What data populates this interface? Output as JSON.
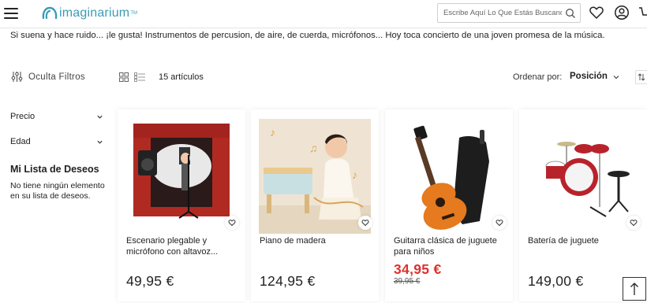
{
  "header": {
    "logo_text": "imaginarium",
    "logo_mark": "TM",
    "search_placeholder": "Escribe Aquí Lo Que Estás Buscando",
    "icons": [
      "menu-icon",
      "search-icon",
      "heart-icon",
      "user-icon",
      "cart-icon"
    ]
  },
  "intro_text": "Si suena y hace ruido... ¡le gusta! Instrumentos de percusion, de aire, de cuerda, micrófonos... Hoy toca concierto de una joven promesa de la música.",
  "toolbar": {
    "filters_label": "Oculta Filtros",
    "count_label": "15 artículos",
    "sort_label": "Ordenar por:",
    "sort_value": "Posición"
  },
  "sidebar": {
    "facets": [
      {
        "label": "Precio"
      },
      {
        "label": "Edad"
      }
    ],
    "wishlist_title": "Mi Lista de Deseos",
    "wishlist_text": "No tiene ningún elemento en su lista de deseos."
  },
  "products": [
    {
      "name": "Escenario plegable y micrófono con altavoz...",
      "price": "49,95 €",
      "image": "stage-microphone-image"
    },
    {
      "name": "Piano de madera",
      "price": "124,95 €",
      "image": "wooden-piano-image"
    },
    {
      "name": "Guitarra clásica de juguete para niños",
      "price": "34,95 €",
      "old_price": "39,95 €",
      "image": "toy-guitar-image"
    },
    {
      "name": "Batería de juguete",
      "price": "149,00 €",
      "image": "toy-drum-kit-image"
    }
  ],
  "colors": {
    "brand": "#3a9bb5",
    "sale_price": "#e0302b",
    "text": "#222222"
  }
}
